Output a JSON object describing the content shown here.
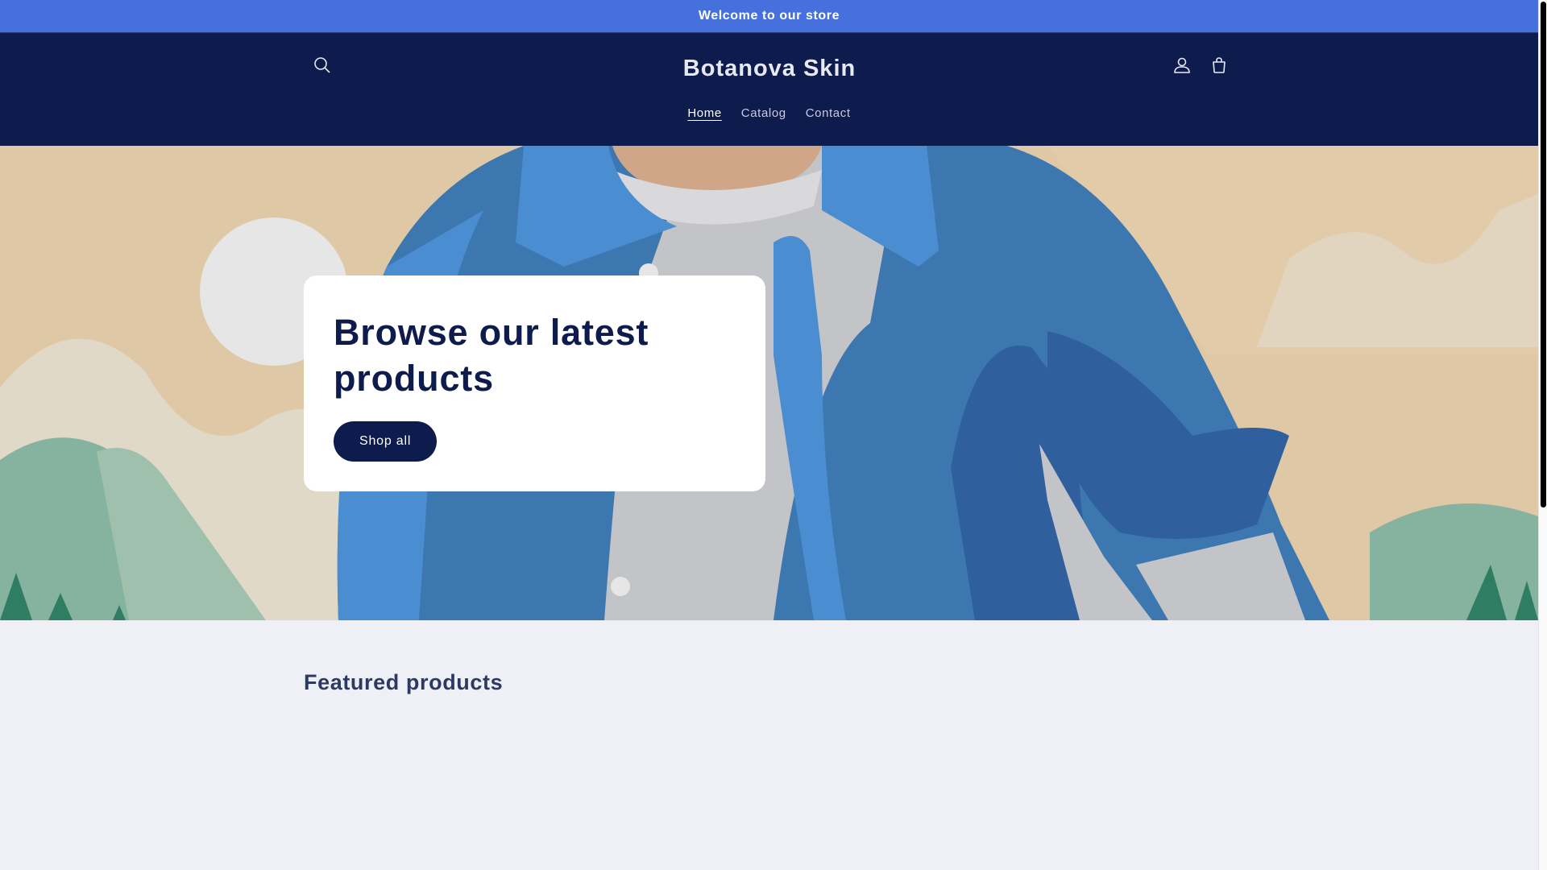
{
  "announcement": {
    "text": "Welcome to our store"
  },
  "header": {
    "brand": "Botanova Skin",
    "nav": [
      {
        "label": "Home",
        "active": true
      },
      {
        "label": "Catalog",
        "active": false
      },
      {
        "label": "Contact",
        "active": false
      }
    ],
    "icons": {
      "search": "search-icon",
      "account": "account-icon",
      "cart": "cart-icon"
    }
  },
  "hero": {
    "title": "Browse our latest products",
    "button_label": "Shop all"
  },
  "featured": {
    "heading": "Featured products"
  },
  "colors": {
    "announcement_bg": "#4670db",
    "header_bg": "#0e1b4d",
    "page_bg": "#eff0f5",
    "hero_sand": "#dfc8a6",
    "jacket_blue": "#3d77b0"
  }
}
